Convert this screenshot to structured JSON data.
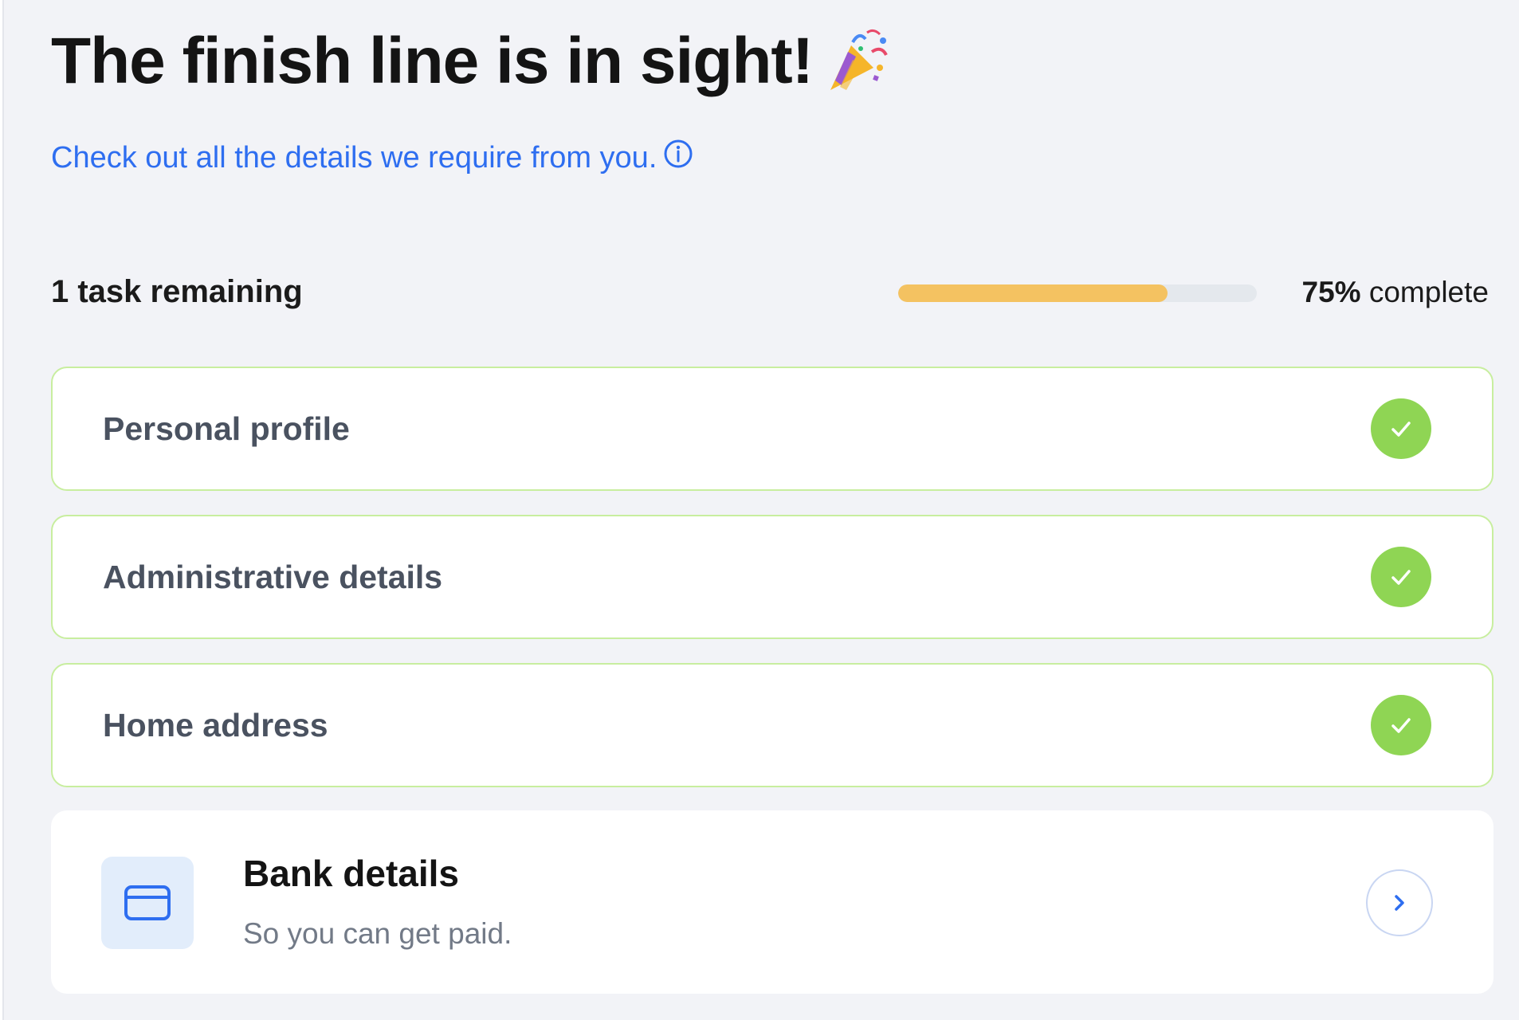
{
  "header": {
    "title": "The finish line is in sight!",
    "title_icon": "party-popper-icon",
    "subtitle": "Check out all the details we require from you.",
    "subtitle_icon": "info-icon"
  },
  "progress": {
    "remaining_label": "1 task remaining",
    "percent_value": "75%",
    "percent_suffix": "complete",
    "fraction": 0.75,
    "fill_color": "#f4c261"
  },
  "tasks": [
    {
      "label": "Personal profile",
      "status": "complete",
      "icon": "check-icon"
    },
    {
      "label": "Administrative details",
      "status": "complete",
      "icon": "check-icon"
    },
    {
      "label": "Home address",
      "status": "complete",
      "icon": "check-icon"
    }
  ],
  "next_task": {
    "title": "Bank details",
    "subtitle": "So you can get paid.",
    "icon": "credit-card-icon",
    "action_icon": "chevron-right-icon"
  },
  "colors": {
    "accent_blue": "#2e6ef0",
    "success_green": "#8fd554",
    "success_border": "#c8ee9f",
    "background": "#f2f3f7"
  }
}
